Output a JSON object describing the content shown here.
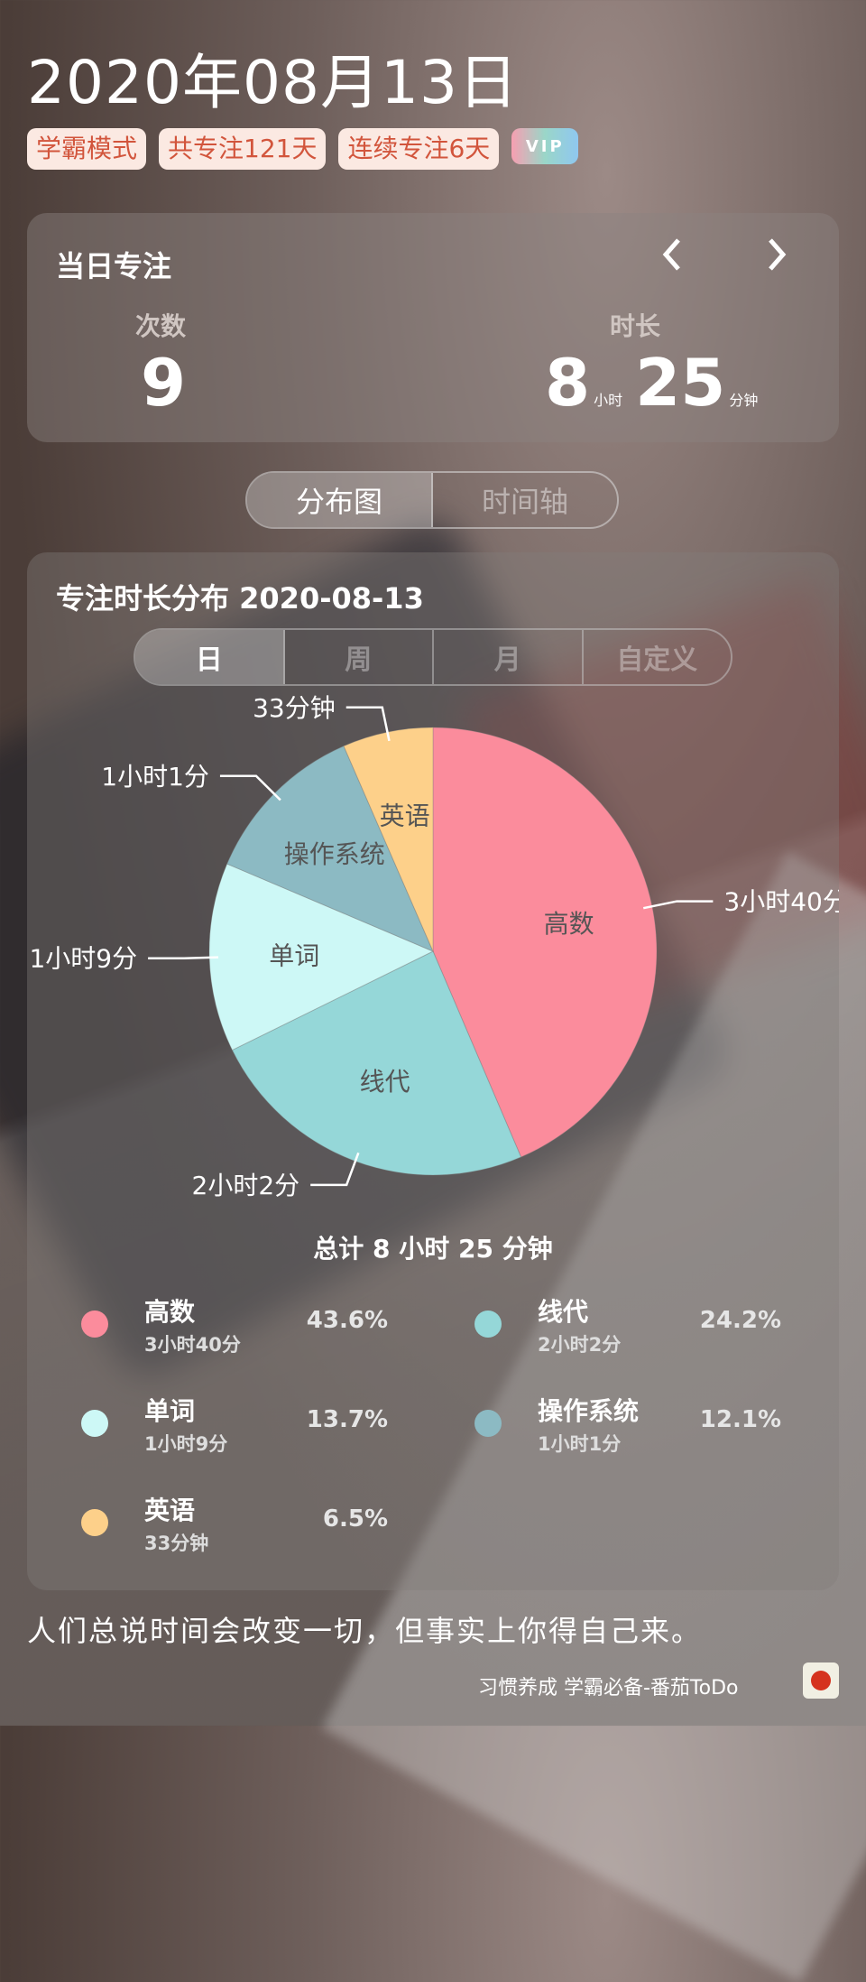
{
  "header": {
    "date": "2020年08月13日",
    "tags": [
      "学霸模式",
      "共专注121天",
      "连续专注6天"
    ],
    "vip_label": "VIP"
  },
  "daily": {
    "title": "当日专注",
    "count_label": "次数",
    "count_value": "9",
    "duration_label": "时长",
    "hours": "8",
    "hours_unit": "小时",
    "minutes": "25",
    "minutes_unit": "分钟"
  },
  "view_tabs": [
    "分布图",
    "时间轴"
  ],
  "distribution": {
    "title": "专注时长分布  2020-08-13",
    "period_tabs": [
      "日",
      "周",
      "月",
      "自定义"
    ],
    "total": "总计 8 小时 25 分钟"
  },
  "chart_data": {
    "type": "pie",
    "slices": [
      {
        "name": "高数",
        "value": 220,
        "label": "3小时40分",
        "percent": "43.6%",
        "color": "#fb8c9c"
      },
      {
        "name": "线代",
        "value": 122,
        "label": "2小时2分",
        "percent": "24.2%",
        "color": "#95d7d8"
      },
      {
        "name": "单词",
        "value": 69,
        "label": "1小时9分",
        "percent": "13.7%",
        "color": "#cdf8f6"
      },
      {
        "name": "操作系统",
        "value": 61,
        "label": "1小时1分",
        "percent": "12.1%",
        "color": "#8cbac3"
      },
      {
        "name": "英语",
        "value": 33,
        "label": "33分钟",
        "percent": "6.5%",
        "color": "#fdd08a"
      }
    ]
  },
  "quote": "人们总说时间会改变一切，但事实上你得自己来。",
  "footer": "习惯养成 学霸必备-番茄ToDo"
}
